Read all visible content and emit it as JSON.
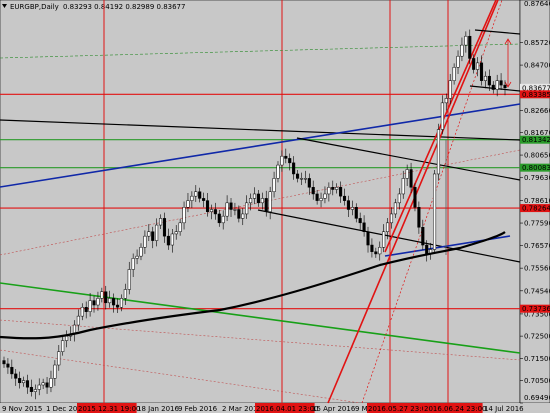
{
  "header": {
    "title": "EURGBP,Daily",
    "ohlc": "0.83293 0.84192 0.82989 0.83677"
  },
  "chart_data": {
    "type": "candlestick",
    "symbol": "EURGBP",
    "timeframe": "Daily",
    "ylim": [
      0.6949,
      0.8763
    ],
    "y_ticks": [
      "0.87640",
      "0.85720",
      "0.84700",
      "0.83677",
      "0.83385",
      "0.82660",
      "0.81670",
      "0.81342",
      "0.80650",
      "0.80083",
      "0.79630",
      "0.78610",
      "0.78264",
      "0.77590",
      "0.76570",
      "0.75560",
      "0.74540",
      "0.73736",
      "0.73500",
      "0.72500",
      "0.71500",
      "0.70500",
      "0.69490"
    ],
    "x_ticks": [
      "9 Nov 2015",
      "1 Dec 201",
      "2015.12.31 19:00",
      "18 Jan 2016",
      "9 Feb 2016",
      "2 Mar 2016",
      "2016.04.01 23:00",
      "15 Apr 2016",
      "9 M",
      "2016.05.27 23:00",
      "2016.06.24 23:00",
      "14 Jul 2016"
    ],
    "last_price": 0.83677,
    "price_line_labels": [
      {
        "value": 0.83677,
        "label": "0.83677",
        "color": "#e8e8e8"
      },
      {
        "value": 0.83385,
        "label": "0.83385",
        "color": "#e11313"
      },
      {
        "value": 0.81342,
        "label": "0.81342",
        "color": "#2a9a2a"
      },
      {
        "value": 0.80083,
        "label": "0.80083",
        "color": "#2a9a2a"
      },
      {
        "value": 0.78264,
        "label": "0.78264",
        "color": "#e11313"
      },
      {
        "value": 0.73736,
        "label": "0.73736",
        "color": "#e11313"
      }
    ],
    "closes": [
      0.7125,
      0.711,
      0.708,
      0.706,
      0.704,
      0.705,
      0.702,
      0.7,
      0.701,
      0.703,
      0.704,
      0.702,
      0.706,
      0.712,
      0.718,
      0.723,
      0.725,
      0.726,
      0.73,
      0.734,
      0.738,
      0.736,
      0.741,
      0.739,
      0.742,
      0.745,
      0.74,
      0.742,
      0.739,
      0.738,
      0.742,
      0.746,
      0.755,
      0.76,
      0.761,
      0.765,
      0.77,
      0.772,
      0.768,
      0.775,
      0.778,
      0.77,
      0.766,
      0.771,
      0.772,
      0.776,
      0.783,
      0.786,
      0.788,
      0.79,
      0.787,
      0.786,
      0.781,
      0.782,
      0.78,
      0.776,
      0.779,
      0.785,
      0.782,
      0.782,
      0.778,
      0.78,
      0.785,
      0.787,
      0.789,
      0.785,
      0.787,
      0.781,
      0.79,
      0.796,
      0.802,
      0.806,
      0.805,
      0.803,
      0.798,
      0.796,
      0.796,
      0.796,
      0.792,
      0.789,
      0.786,
      0.787,
      0.789,
      0.792,
      0.791,
      0.792,
      0.788,
      0.786,
      0.782,
      0.783,
      0.778,
      0.776,
      0.772,
      0.766,
      0.763,
      0.762,
      0.765,
      0.772,
      0.776,
      0.78,
      0.785,
      0.789,
      0.796,
      0.8,
      0.792,
      0.783,
      0.774,
      0.766,
      0.762,
      0.764,
      0.798,
      0.818,
      0.83,
      0.832,
      0.84,
      0.846,
      0.851,
      0.856,
      0.86,
      0.85,
      0.845,
      0.848,
      0.84,
      0.842,
      0.838,
      0.836,
      0.84,
      0.838,
      0.8368
    ]
  }
}
